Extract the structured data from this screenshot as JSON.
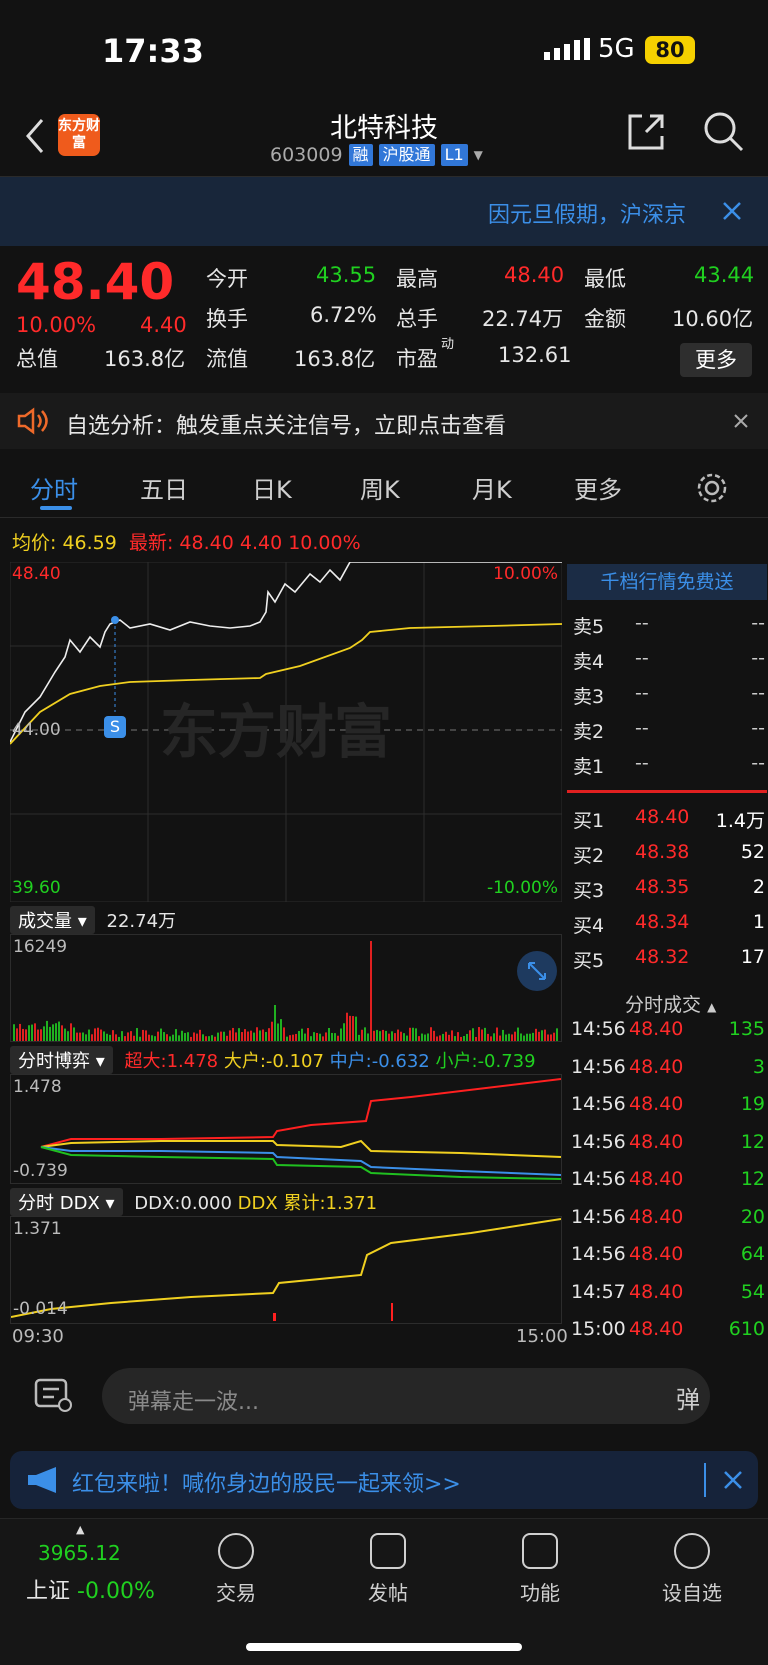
{
  "status": {
    "time": "17:33",
    "network": "5G",
    "battery": "80"
  },
  "header": {
    "title": "北特科技",
    "code": "603009",
    "tags": [
      "融",
      "沪股通",
      "L1"
    ],
    "logo": "东方财富"
  },
  "notice": {
    "text": "因元旦假期，沪深京"
  },
  "quote": {
    "price": "48.40",
    "change_pct": "10.00%",
    "change": "4.40",
    "items": [
      {
        "k": "今开",
        "v": "43.55",
        "c": "green"
      },
      {
        "k": "最高",
        "v": "48.40",
        "c": "red"
      },
      {
        "k": "最低",
        "v": "43.44",
        "c": "green"
      },
      {
        "k": "换手",
        "v": "6.72%",
        "c": "white"
      },
      {
        "k": "总手",
        "v": "22.74万",
        "c": "white"
      },
      {
        "k": "金额",
        "v": "10.60亿",
        "c": "white"
      },
      {
        "k": "总值",
        "v": "163.8亿",
        "c": "white"
      },
      {
        "k": "流值",
        "v": "163.8亿",
        "c": "white"
      },
      {
        "k": "市盈",
        "v": "132.61",
        "c": "white"
      }
    ],
    "pe_sup": "动",
    "more": "更多"
  },
  "signal": {
    "text": "自选分析：触发重点关注信号，立即点击查看"
  },
  "tabs": [
    "分时",
    "五日",
    "日K",
    "周K",
    "月K",
    "更多"
  ],
  "avg": {
    "avg_label": "均价:",
    "avg": "46.59",
    "latest_label": "最新:",
    "latest": "48.40",
    "chg": "4.40",
    "pct": "10.00%"
  },
  "chart": {
    "high": "48.40",
    "low": "39.60",
    "mid": "44.00",
    "pct_high": "10.00%",
    "pct_low": "-10.00%",
    "watermark": "东方财富",
    "marker": "S",
    "time_start": "09:30",
    "time_end": "15:00"
  },
  "volume": {
    "label": "成交量",
    "total": "22.74万",
    "max": "16249"
  },
  "bo": {
    "label": "分时博弈",
    "super": "超大:1.478",
    "big": "大户:-0.107",
    "mid": "中户:-0.632",
    "small": "小户:-0.739",
    "top": "1.478",
    "bottom": "-0.739"
  },
  "ddx": {
    "label": "分时 DDX",
    "ddx": "DDX:0.000",
    "cum": "DDX 累计:1.371",
    "top": "1.371",
    "bottom": "-0.014"
  },
  "book": {
    "banner": "千档行情免费送",
    "sells": [
      {
        "k": "卖5",
        "p": "--",
        "v": "--"
      },
      {
        "k": "卖4",
        "p": "--",
        "v": "--"
      },
      {
        "k": "卖3",
        "p": "--",
        "v": "--"
      },
      {
        "k": "卖2",
        "p": "--",
        "v": "--"
      },
      {
        "k": "卖1",
        "p": "--",
        "v": "--"
      }
    ],
    "buys": [
      {
        "k": "买1",
        "p": "48.40",
        "v": "1.4万"
      },
      {
        "k": "买2",
        "p": "48.38",
        "v": "52"
      },
      {
        "k": "买3",
        "p": "48.35",
        "v": "2"
      },
      {
        "k": "买4",
        "p": "48.34",
        "v": "1"
      },
      {
        "k": "买5",
        "p": "48.32",
        "v": "17"
      }
    ],
    "trades_label": "分时成交",
    "trades": [
      {
        "t": "14:56",
        "p": "48.40",
        "v": "135"
      },
      {
        "t": "14:56",
        "p": "48.40",
        "v": "3"
      },
      {
        "t": "14:56",
        "p": "48.40",
        "v": "19"
      },
      {
        "t": "14:56",
        "p": "48.40",
        "v": "12"
      },
      {
        "t": "14:56",
        "p": "48.40",
        "v": "12"
      },
      {
        "t": "14:56",
        "p": "48.40",
        "v": "20"
      },
      {
        "t": "14:56",
        "p": "48.40",
        "v": "64"
      },
      {
        "t": "14:57",
        "p": "48.40",
        "v": "54"
      },
      {
        "t": "15:00",
        "p": "48.40",
        "v": "610"
      }
    ]
  },
  "input": {
    "placeholder": "弹幕走一波...",
    "danmu_btn": "弹"
  },
  "redpacket": {
    "text": "红包来啦！喊你身边的股民一起来领>>"
  },
  "bottom": {
    "index_value": "3965.12",
    "index_name": "上证",
    "index_chg": "-0.00%",
    "nav": [
      "交易",
      "发帖",
      "功能",
      "设自选"
    ]
  }
}
